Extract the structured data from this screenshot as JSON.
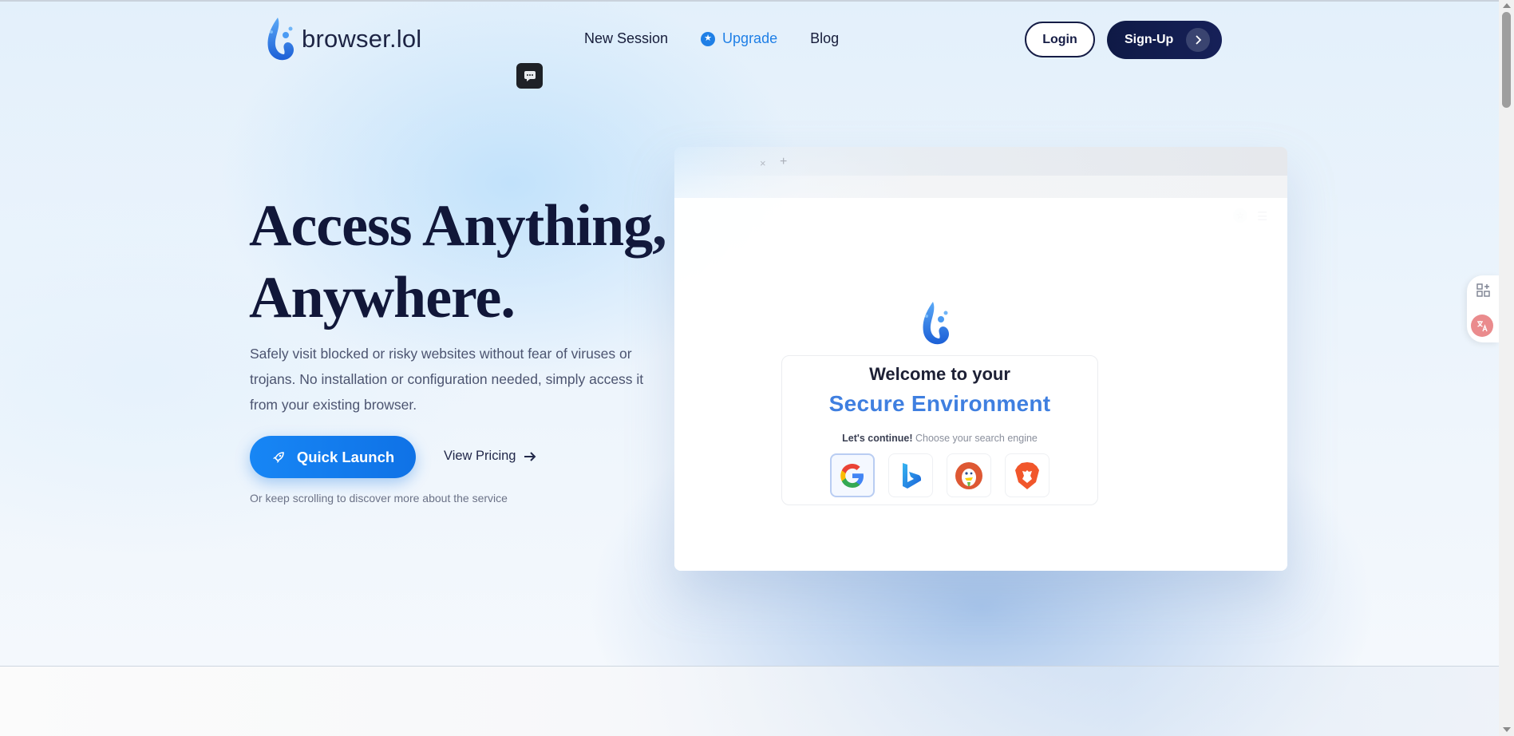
{
  "brand": {
    "name": "browser.lol",
    "logo_icon": "water-drop-logo-icon",
    "accent_color": "#1f7fe6",
    "dark_color": "#111739"
  },
  "nav": {
    "items": [
      {
        "label": "New Session"
      },
      {
        "label": "Upgrade",
        "icon": "star-badge-icon"
      },
      {
        "label": "Blog"
      }
    ]
  },
  "auth": {
    "login_label": "Login",
    "signup_label": "Sign-Up"
  },
  "hero": {
    "title_line1": "Access Anything,",
    "title_line2": "Anywhere.",
    "subtitle": "Safely visit blocked or risky websites without fear of viruses or trojans. No installation or configuration needed, simply access it from your existing browser.",
    "quick_launch_label": "Quick Launch",
    "view_pricing_label": "View Pricing",
    "scroll_hint": "Or keep scrolling to discover more about the service"
  },
  "mock_browser": {
    "tab_close": "×",
    "tab_plus": "+",
    "welcome_line1": "Welcome to your",
    "welcome_line2": "Secure Environment",
    "continue_bold": "Let's continue!",
    "continue_rest": "Choose your search engine",
    "engines": [
      {
        "icon": "google-icon",
        "selected": true
      },
      {
        "icon": "bing-icon"
      },
      {
        "icon": "duckduckgo-icon"
      },
      {
        "icon": "brave-icon"
      }
    ]
  }
}
